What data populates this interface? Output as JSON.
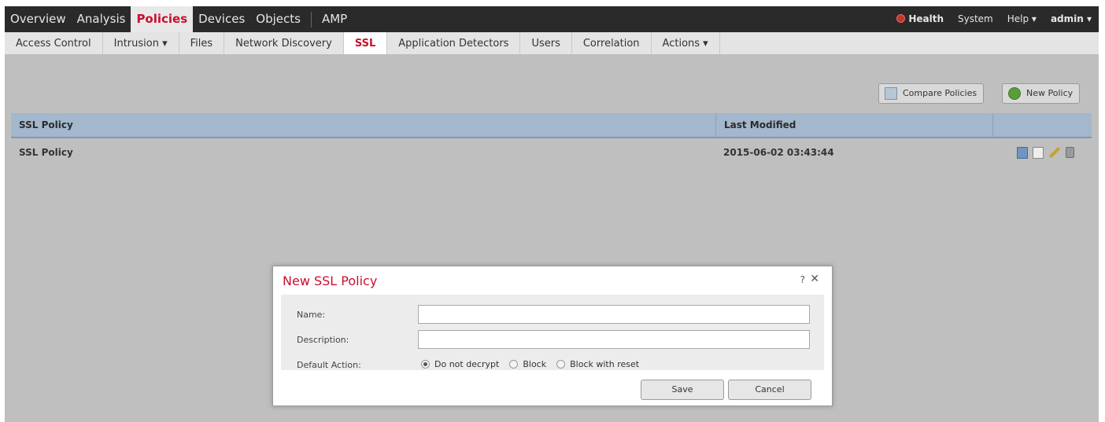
{
  "topnav": {
    "items": [
      "Overview",
      "Analysis",
      "Policies",
      "Devices",
      "Objects",
      "AMP"
    ],
    "active": "Policies",
    "health": "Health",
    "system": "System",
    "help": "Help ▾",
    "user": "admin ▾"
  },
  "subnav": {
    "tabs": [
      "Access Control",
      "Intrusion ▾",
      "Files",
      "Network Discovery",
      "SSL",
      "Application Detectors",
      "Users",
      "Correlation",
      "Actions ▾"
    ],
    "active": "SSL"
  },
  "toolbar": {
    "compare_label": "Compare Policies",
    "new_label": "New Policy"
  },
  "table": {
    "columns": [
      "SSL Policy",
      "Last Modified",
      ""
    ],
    "rows": [
      {
        "name": "SSL Policy",
        "modified": "2015-06-02 03:43:44"
      }
    ]
  },
  "dialog": {
    "title": "New SSL Policy",
    "help": "?",
    "close": "✕",
    "name_label": "Name:",
    "name_value": "",
    "description_label": "Description:",
    "description_value": "",
    "default_action_label": "Default Action:",
    "options": [
      "Do not decrypt",
      "Block",
      "Block with reset"
    ],
    "selected_option": "Do not decrypt",
    "save_label": "Save",
    "cancel_label": "Cancel"
  },
  "colors": {
    "accent": "#c8102e",
    "topnav_bg": "#2a2a2a",
    "table_header": "#a3b7cd"
  }
}
